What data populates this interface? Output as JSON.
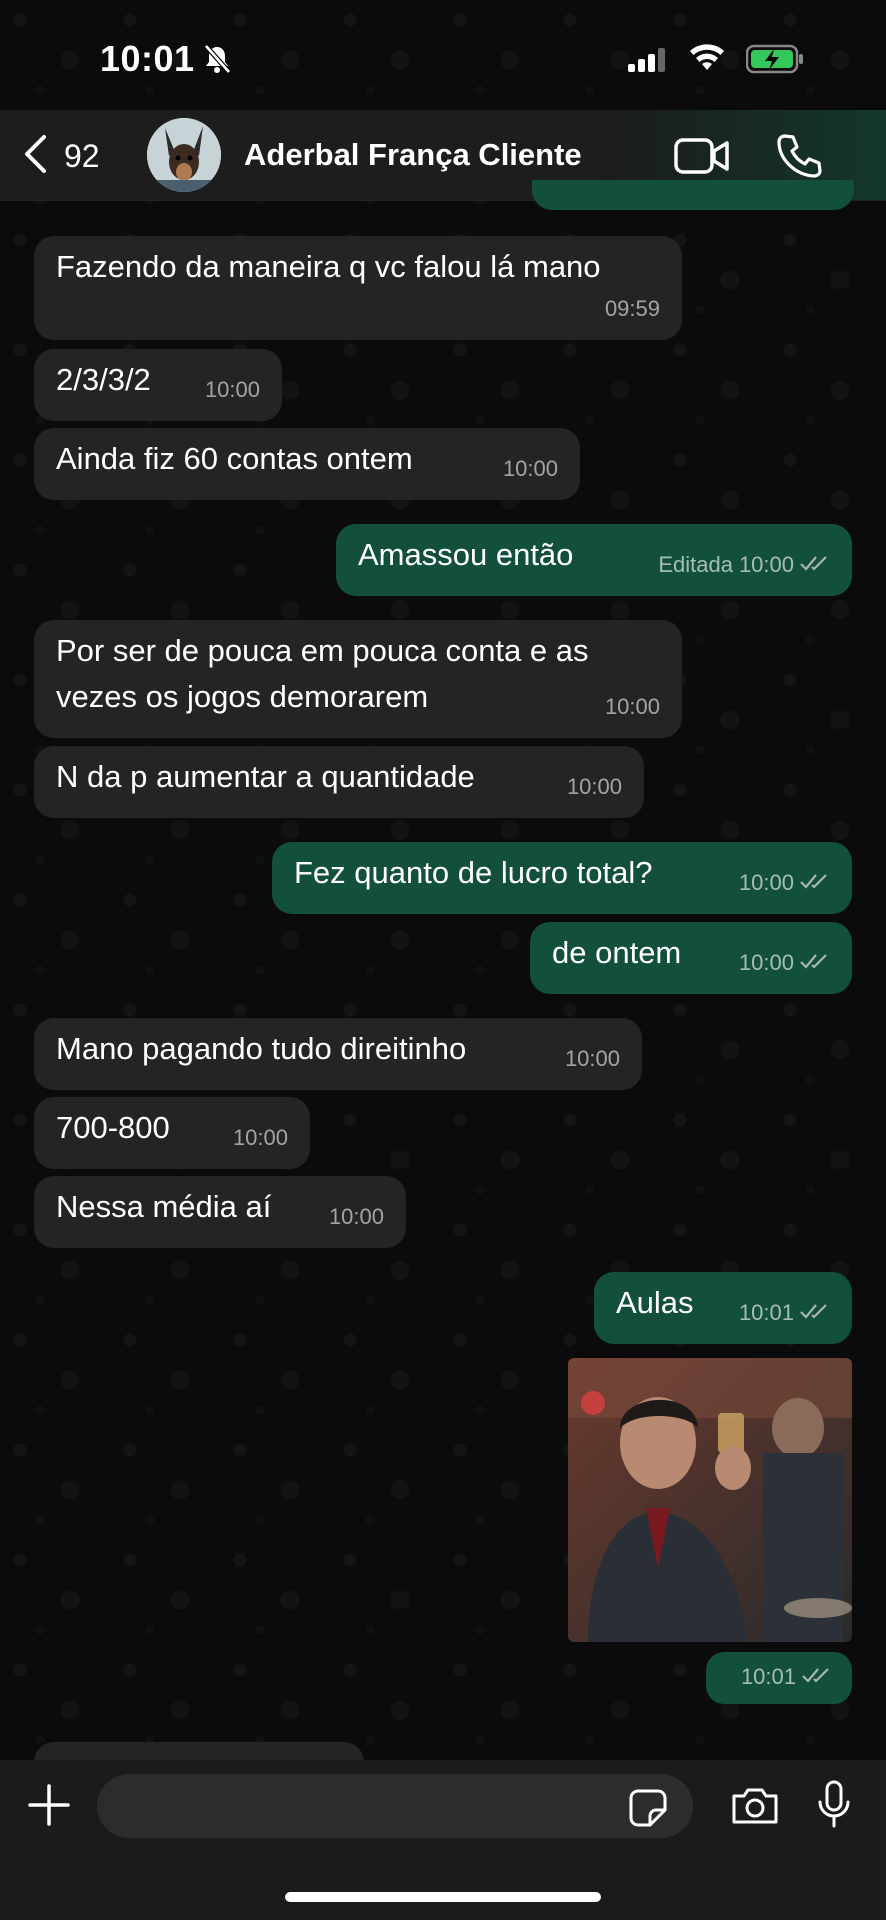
{
  "status_bar": {
    "time": "10:01"
  },
  "header": {
    "back_count": "92",
    "contact_name": "Aderbal França Cliente"
  },
  "messages": [
    {
      "text": "Fazendo da maneira q vc falou lá mano",
      "time": "09:59"
    },
    {
      "text": "2/3/3/2",
      "time": "10:00"
    },
    {
      "text": "Ainda fiz 60 contas ontem",
      "time": "10:00"
    },
    {
      "text": "Amassou então",
      "edited": "Editada",
      "time": "10:00"
    },
    {
      "text": "Por ser de pouca em pouca conta e as vezes os jogos demorarem",
      "time": "10:00"
    },
    {
      "text": "N da p aumentar a quantidade",
      "time": "10:00"
    },
    {
      "text": "Fez quanto de lucro total?",
      "time": "10:00"
    },
    {
      "text": "de ontem",
      "time": "10:00"
    },
    {
      "text": "Mano pagando tudo direitinho",
      "time": "10:00"
    },
    {
      "text": "700-800",
      "time": "10:00"
    },
    {
      "text": "Nessa média aí",
      "time": "10:00"
    },
    {
      "text": "Aulas",
      "time": "10:01"
    },
    {
      "text": "",
      "time": "10:01"
    }
  ],
  "colors": {
    "incoming": "#242426",
    "outgoing": "#13503b",
    "read_tick": "#a8b5b0"
  },
  "icons": [
    "chevron-left-icon",
    "video-camera-icon",
    "phone-icon",
    "plus-icon",
    "sticker-icon",
    "camera-icon",
    "microphone-icon"
  ]
}
